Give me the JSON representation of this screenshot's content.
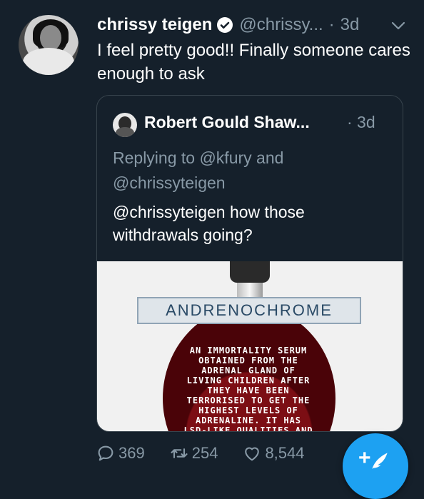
{
  "tweet": {
    "author_name": "chrissy teigen",
    "author_handle": "@chrissy...",
    "separator": "·",
    "time": "3d",
    "text": "I feel pretty good!! Finally someone cares enough to ask"
  },
  "quoted_tweet": {
    "author_name": "Robert Gould Shaw...",
    "time": "· 3d",
    "replying_to": "Replying to @kfury and @chrissyteigen",
    "text": "@chrissyteigen how those withdrawals going?",
    "image": {
      "label": "ANDRENOCHROME",
      "body": "AN IMMORTALITY SERUM\nOBTAINED FROM THE\nADRENAL GLAND OF\nLIVING CHILDREN AFTER\nTHEY HAVE BEEN\nTERRORISED TO GET THE\nHIGHEST LEVELS OF\nADRENALINE. IT HAS\nLSD-LIKE QUALITIES AND"
    }
  },
  "actions": {
    "replies": "369",
    "retweets": "254",
    "likes": "8,544"
  },
  "icons": {
    "verified": "verified-badge-icon",
    "menu": "chevron-down-icon",
    "reply": "reply-icon",
    "retweet": "retweet-icon",
    "like": "heart-icon",
    "compose": "compose-tweet-icon"
  },
  "colors": {
    "background": "#15202b",
    "secondary_text": "#8899a6",
    "accent": "#1da1f2",
    "border": "#38444d"
  }
}
